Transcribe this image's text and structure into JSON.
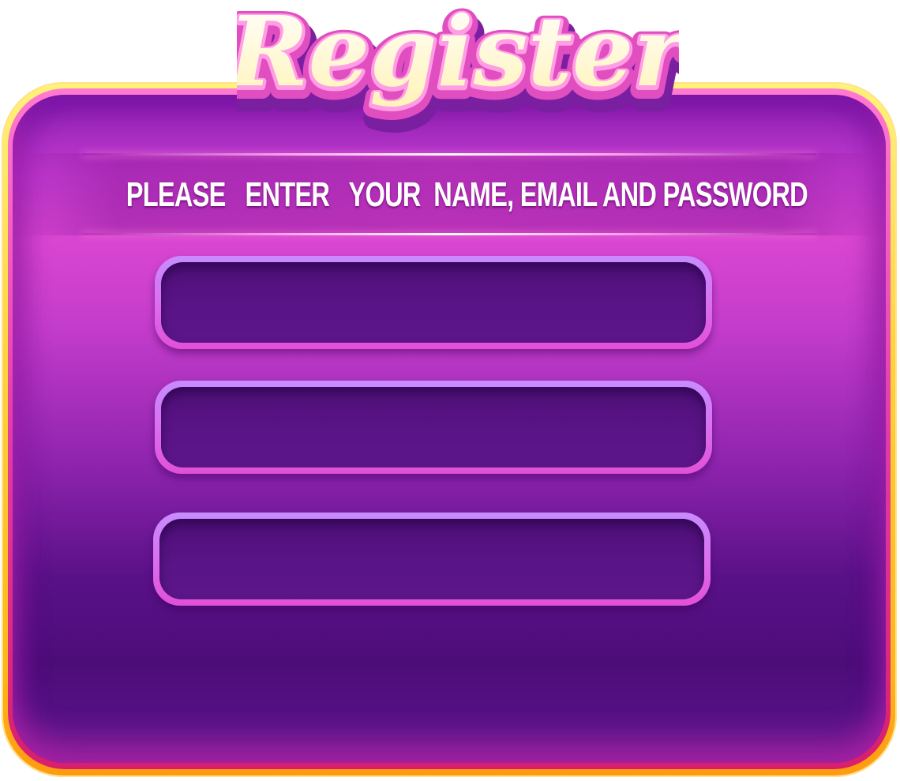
{
  "title": "Register",
  "instruction": "PLEASE   ENTER   YOUR  NAME, EMAIL AND PASSWORD",
  "fields": [
    {
      "value": "",
      "placeholder": ""
    },
    {
      "value": "",
      "placeholder": ""
    },
    {
      "value": "",
      "placeholder": ""
    }
  ],
  "colors": {
    "frame": "#ffc832",
    "panel": "#5a1188",
    "accent": "#e24fd8",
    "title_fill": "#fffbd0",
    "title_outline": "#e04ec0"
  }
}
